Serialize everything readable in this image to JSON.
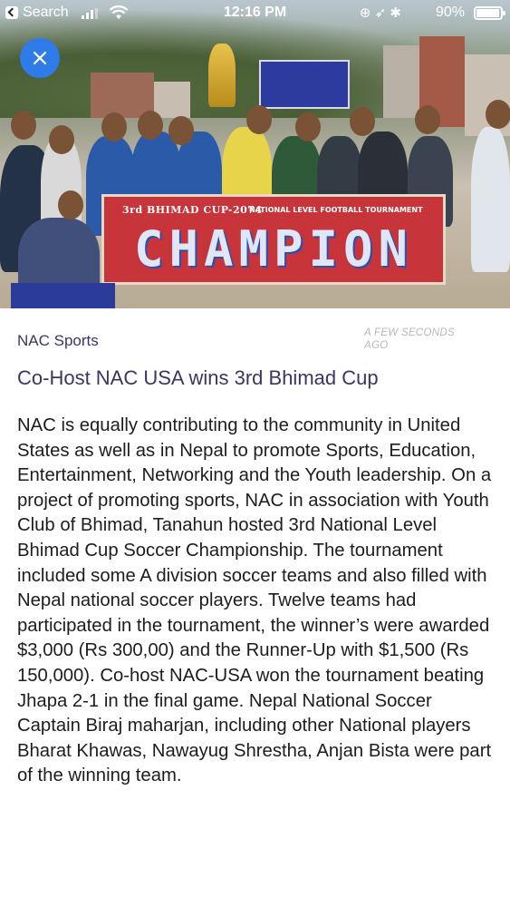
{
  "status_bar": {
    "back_app": "Search",
    "time": "12:16 PM",
    "battery": "90%"
  },
  "hero": {
    "banner_top_left": "3rd BHIMAD CUP-2074",
    "banner_top_right": "NATIONAL LEVEL FOOTBALL TOURNAMENT",
    "banner_main": "CHAMPION",
    "close_icon": "close-icon"
  },
  "article": {
    "category": "NAC Sports",
    "timestamp": "A FEW SECONDS AGO",
    "headline": "Co-Host NAC USA wins 3rd Bhimad Cup",
    "body": "NAC is equally contributing to the community in United States as well as in Nepal to promote Sports, Education, Entertainment, Networking and the Youth leadership. On a project of promoting sports, NAC in association with Youth Club of Bhimad, Tanahun hosted 3rd National Level Bhimad Cup Soccer Championship. The tournament included some A division soccer teams and also filled with Nepal national soccer players. Twelve teams had participated in the tournament, the winner’s were awarded $3,000 (Rs 300,00) and the Runner-Up with $1,500 (Rs 150,000). Co-host NAC-USA won the tournament beating Jhapa 2-1 in the final game. Nepal National Soccer Captain Biraj maharjan, including other National players Bharat Khawas, Nawayug Shrestha, Anjan Bista were part of the winning team."
  },
  "colors": {
    "accent": "#2f7bea",
    "headline": "#3b3566",
    "banner": "#c7343a"
  }
}
